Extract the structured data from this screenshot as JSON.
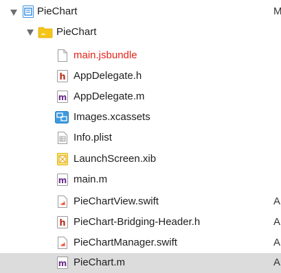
{
  "tree": {
    "project": {
      "label": "PieChart",
      "status": "M",
      "icon": "project-document-icon"
    },
    "group": {
      "label": "PieChart",
      "icon": "yellow-folder-icon"
    },
    "files": [
      {
        "label": "main.jsbundle",
        "icon": "generic-file-icon",
        "status": ""
      },
      {
        "label": "AppDelegate.h",
        "icon": "header-h-icon",
        "status": ""
      },
      {
        "label": "AppDelegate.m",
        "icon": "objc-m-icon",
        "status": ""
      },
      {
        "label": "Images.xcassets",
        "icon": "asset-catalog-icon",
        "status": ""
      },
      {
        "label": "Info.plist",
        "icon": "plist-icon",
        "status": ""
      },
      {
        "label": "LaunchScreen.xib",
        "icon": "xib-icon",
        "status": ""
      },
      {
        "label": "main.m",
        "icon": "objc-m-icon",
        "status": ""
      },
      {
        "label": "PieChartView.swift",
        "icon": "swift-icon",
        "status": "A"
      },
      {
        "label": "PieChart-Bridging-Header.h",
        "icon": "header-h-icon",
        "status": "A"
      },
      {
        "label": "PieChartManager.swift",
        "icon": "swift-icon",
        "status": "A"
      },
      {
        "label": "PieChart.m",
        "icon": "objc-m-icon",
        "status": "A"
      }
    ]
  },
  "colors": {
    "missing_file_text": "#e2231a",
    "selected_row": "#dcdcdc",
    "header_icon": "#b8321f",
    "objc_icon": "#6b2f8c",
    "swift_icon": "#f05138",
    "folder": "#f5c518",
    "asset_catalog": "#3d9be0"
  }
}
